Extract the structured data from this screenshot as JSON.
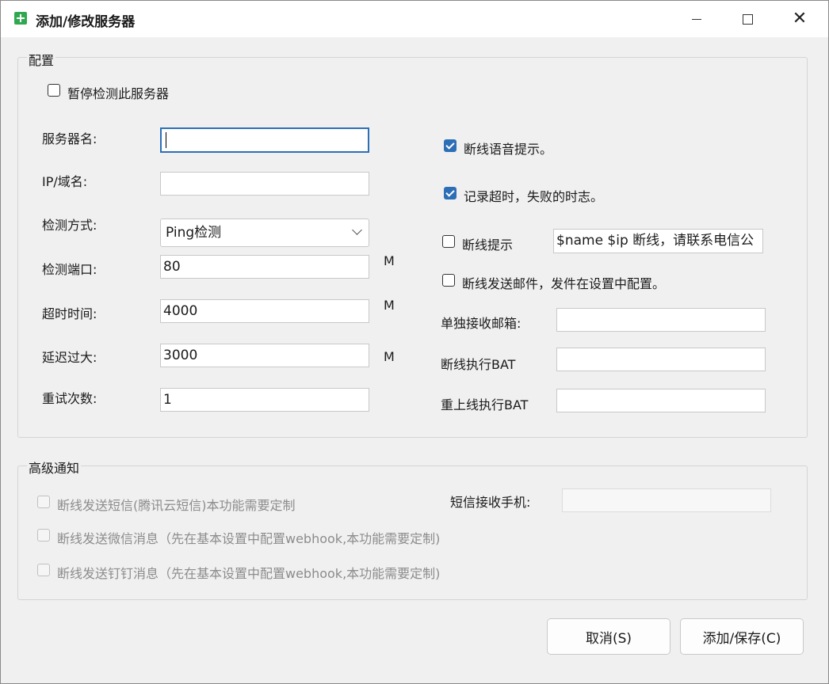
{
  "window": {
    "title": "添加/修改服务器",
    "icon": "green-plus-icon",
    "controls": {
      "minimize": "minimize-icon",
      "maximize": "maximize-icon",
      "close": "close-icon"
    }
  },
  "config": {
    "group_title": "配置",
    "pause_check": {
      "label": "暂停检测此服务器",
      "checked": false
    },
    "server_name": {
      "label": "服务器名:",
      "value": ""
    },
    "ip_domain": {
      "label": "IP/域名:",
      "value": ""
    },
    "check_method": {
      "label": "检测方式:",
      "value": "Ping检测"
    },
    "check_port": {
      "label": "检测端口:",
      "value": "80",
      "unit": "M"
    },
    "timeout": {
      "label": "超时时间:",
      "value": "4000",
      "unit": "M"
    },
    "delay": {
      "label": "延迟过大:",
      "value": "3000",
      "unit": "M"
    },
    "retry": {
      "label": "重试次数:",
      "value": "1"
    },
    "voice_alert": {
      "label": "断线语音提示。",
      "checked": true
    },
    "log_timeout": {
      "label": "记录超时，失败的时志。",
      "checked": true
    },
    "offline_tip": {
      "label": "断线提示",
      "checked": false,
      "value": "$name $ip 断线，请联系电信公"
    },
    "offline_mail": {
      "label": "断线发送邮件，发件在设置中配置。",
      "checked": false
    },
    "receive_mail": {
      "label": "单独接收邮箱:",
      "value": ""
    },
    "offline_bat": {
      "label": "断线执行BAT",
      "value": ""
    },
    "online_bat": {
      "label": "重上线执行BAT",
      "value": ""
    }
  },
  "advanced": {
    "group_title": "高级通知",
    "sms": {
      "label": "断线发送短信(腾讯云短信)本功能需要定制",
      "checked": false
    },
    "wechat": {
      "label": "断线发送微信消息（先在基本设置中配置webhook,本功能需要定制)",
      "checked": false
    },
    "dingtalk": {
      "label": "断线发送钉钉消息（先在基本设置中配置webhook,本功能需要定制)",
      "checked": false
    },
    "sms_phone": {
      "label": "短信接收手机:",
      "value": ""
    }
  },
  "buttons": {
    "cancel": "取消(S)",
    "save": "添加/保存(C)"
  },
  "colors": {
    "accent": "#2c6fb6",
    "icon_green": "#2fa84f"
  }
}
